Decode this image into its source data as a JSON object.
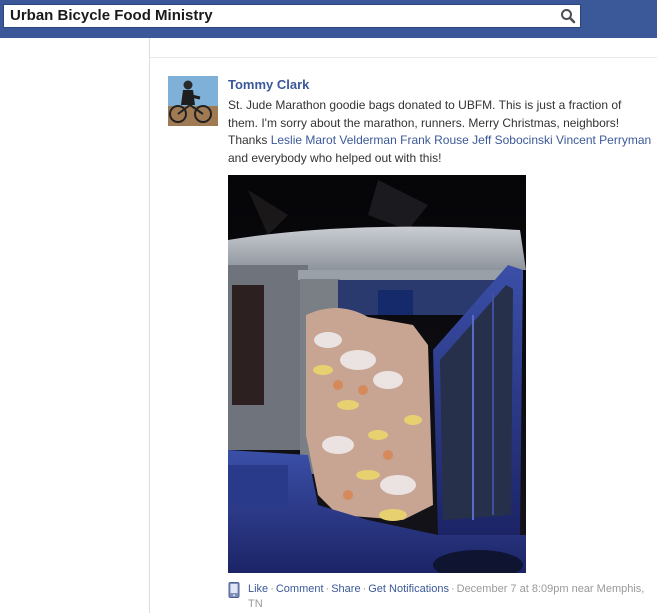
{
  "search": {
    "value": "Urban Bicycle Food Ministry",
    "icon": "search-icon"
  },
  "post": {
    "author": "Tommy Clark",
    "text_parts": {
      "intro": "St. Jude Marathon goodie bags donated to UBFM. This is just a fraction of them. I'm sorry about the marathon, runners. Merry Christmas, neighbors! Thanks",
      "tag1": "Leslie Marot Velderman",
      "tag2": "Frank Rouse",
      "tag3": "Jeff Sobocinski",
      "tag4": "Vincent Perryman",
      "outro": "and everybody who helped out with this!"
    },
    "photo_icon": "jeep-with-goodie-bags-photo"
  },
  "footer": {
    "like": "Like",
    "comment": "Comment",
    "share": "Share",
    "notifications": "Get Notifications",
    "sep": "·",
    "timestamp": "December 7 at 8:09pm",
    "near_word": "near",
    "location": "Memphis, TN"
  },
  "colors": {
    "brand": "#3b5998",
    "text": "#333333",
    "meta": "#999999"
  }
}
